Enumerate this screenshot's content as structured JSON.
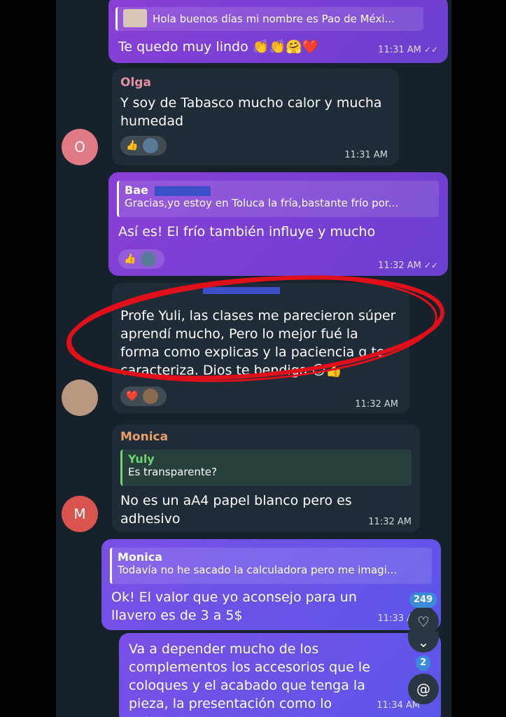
{
  "messages": {
    "m1": {
      "quote_text": "Hola buenos días mi nombre es Pao de Méxi...",
      "text": "Te quedo muy lindo 👏👏🤗❤️",
      "time": "11:31 AM",
      "ticks": "✓✓"
    },
    "m2": {
      "sender": "Olga",
      "text": "Y soy de Tabasco mucho calor y mucha humedad",
      "time": "11:31 AM",
      "avatar": "O"
    },
    "m3": {
      "quote_name": "Bae",
      "quote_text": "Gracias,yo estoy en Toluca la fría,bastante frío por...",
      "text": "Así es! El frío también influye y mucho",
      "time": "11:32 AM",
      "ticks": "✓✓"
    },
    "m4": {
      "text": "Profe Yuli, las clases me parecieron súper aprendí mucho, Pero lo mejor fué la forma como explicas y la paciencia q te caracteriza. Dios te bendiga 😊👍",
      "time": "11:32 AM"
    },
    "m5": {
      "sender": "Monica",
      "quote_name": "Yuly",
      "quote_text": "Es transparente?",
      "text": "No es un aA4 papel blanco pero es adhesivo",
      "time": "11:32 AM",
      "avatar": "M"
    },
    "m6": {
      "quote_name": "Monica",
      "quote_text": "Todavía no he sacado la calculadora pero me imagi...",
      "text": "Ok! El valor que yo aconsejo para un llavero es de 3 a 5$",
      "time": "11:33 A"
    },
    "m7": {
      "text": "Va a depender mucho de los complementos los accesorios que le coloques y el acabado que tenga la pieza, la presentación como lo entregues.",
      "time": "11:34 AM"
    }
  },
  "reactions": {
    "thumbs": "👍",
    "heart": "❤️"
  },
  "overlay": {
    "unread_count": "249",
    "mentions_count": "2",
    "heart_icon": "♡",
    "chevron_icon": "⌄",
    "at_icon": "@"
  },
  "colors": {
    "outgoing": "#8a3fd6",
    "incoming": "#1f2c37",
    "annotation_circle": "#e0101a"
  }
}
